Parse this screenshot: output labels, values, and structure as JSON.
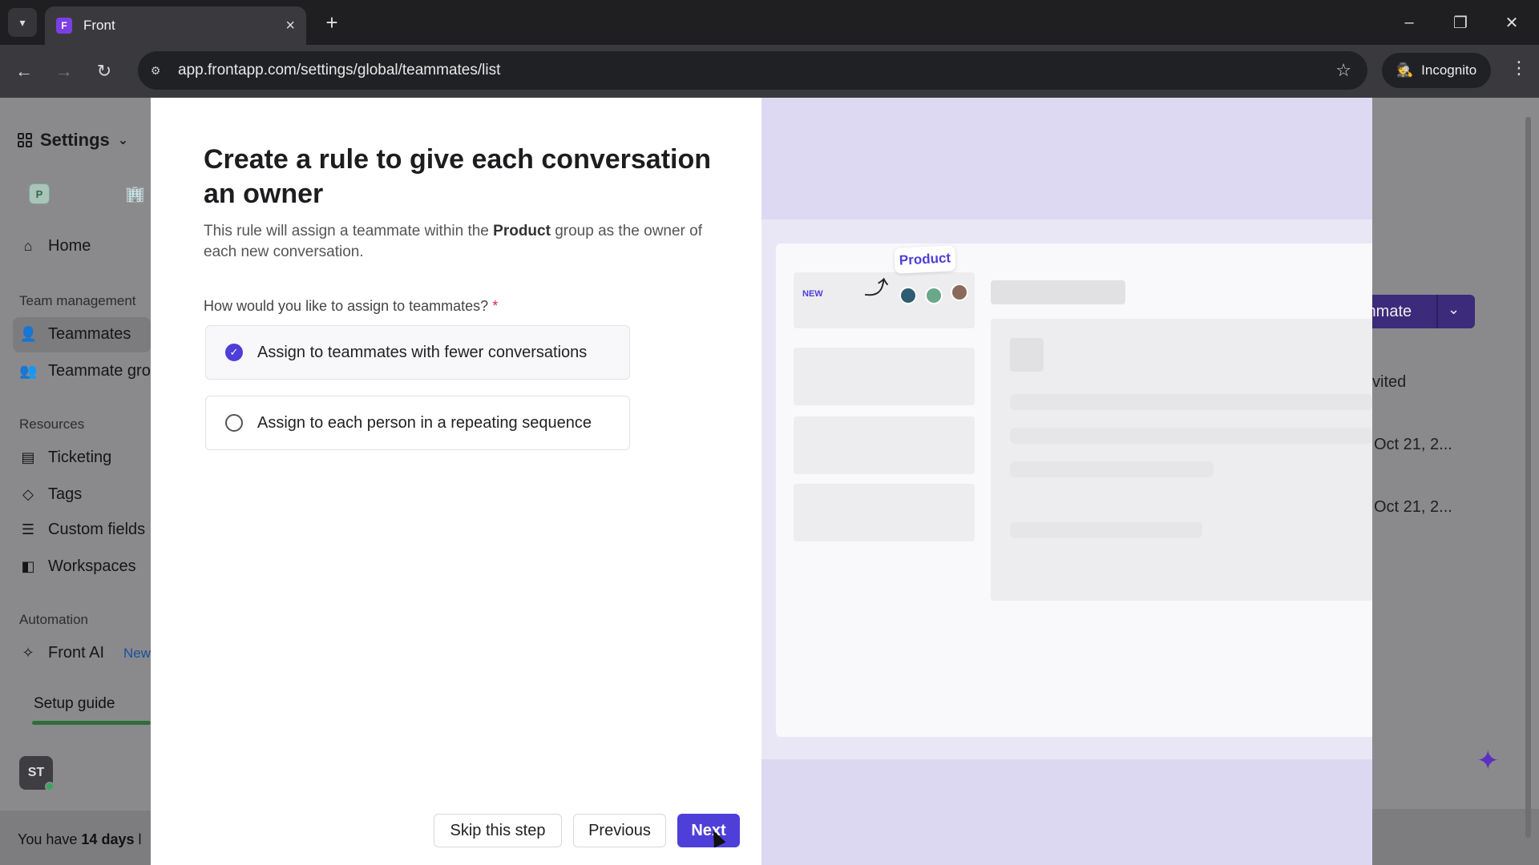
{
  "browser": {
    "tab_title": "Front",
    "url": "app.frontapp.com/settings/global/teammates/list",
    "profile_label": "Incognito"
  },
  "sidebar": {
    "title": "Settings",
    "workspace_badge": "P",
    "home": "Home",
    "sections": {
      "team_management": "Team management",
      "resources": "Resources",
      "automation": "Automation"
    },
    "items": {
      "teammates": "Teammates",
      "teammate_groups": "Teammate gro",
      "ticketing": "Ticketing",
      "tags": "Tags",
      "custom_fields": "Custom fields",
      "workspaces": "Workspaces",
      "front_ai": "Front AI",
      "front_ai_badge": "New"
    },
    "setup_guide": "Setup guide",
    "avatar_initials": "ST",
    "trial_prefix": "You have ",
    "trial_days": "14 days",
    "trial_suffix": " l"
  },
  "background": {
    "add_button": "mmate",
    "column_header": "vited",
    "dates": [
      "Oct 21, 2...",
      "Oct 21, 2..."
    ]
  },
  "modal": {
    "title": "Create a rule to give each conversation an owner",
    "desc_prefix": "This rule will assign a teammate within the ",
    "desc_group": "Product",
    "desc_suffix": " group as the owner of each new conversation.",
    "question": "How would you like to assign to teammates?",
    "required_mark": "*",
    "options": [
      {
        "label": "Assign to teammates with fewer conversations",
        "selected": true
      },
      {
        "label": "Assign to each person in a repeating sequence",
        "selected": false
      }
    ],
    "buttons": {
      "skip": "Skip this step",
      "previous": "Previous",
      "next": "Next"
    },
    "illustration": {
      "group_pill": "Product",
      "new_tag": "NEW"
    }
  },
  "colors": {
    "accent": "#4f3fd9",
    "illustration_bg": "#ddd9f3"
  }
}
